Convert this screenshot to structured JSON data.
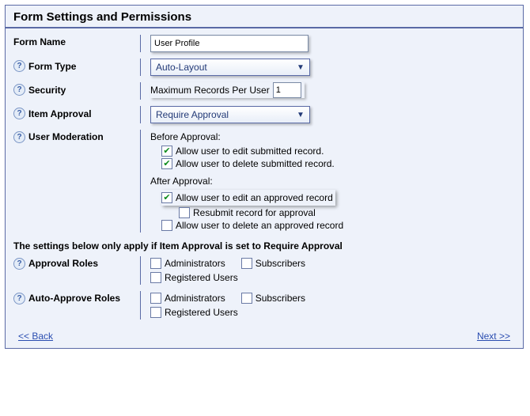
{
  "title": "Form Settings and Permissions",
  "labels": {
    "form_name": "Form Name",
    "form_type": "Form Type",
    "security": "Security",
    "item_approval": "Item Approval",
    "user_moderation": "User Moderation",
    "approval_roles": "Approval Roles",
    "auto_approve_roles": "Auto-Approve Roles"
  },
  "form_name_value": "User Profile",
  "form_type_value": "Auto-Layout",
  "security_max_label": "Maximum Records Per User",
  "security_max_value": "1",
  "item_approval_value": "Require Approval",
  "moderation": {
    "before_label": "Before Approval:",
    "after_label": "After Approval:",
    "allow_edit_submitted": "Allow user to edit submitted record.",
    "allow_delete_submitted": "Allow user to delete submitted record.",
    "allow_edit_approved": "Allow user to edit an approved record",
    "resubmit": "Resubmit record for approval",
    "allow_delete_approved": "Allow user to delete an approved record"
  },
  "roles": {
    "administrators": "Administrators",
    "subscribers": "Subscribers",
    "registered_users": "Registered Users"
  },
  "note_text": "The settings below only apply if Item Approval is set to Require Approval",
  "footer": {
    "back": "<< Back",
    "next": "Next >>"
  }
}
